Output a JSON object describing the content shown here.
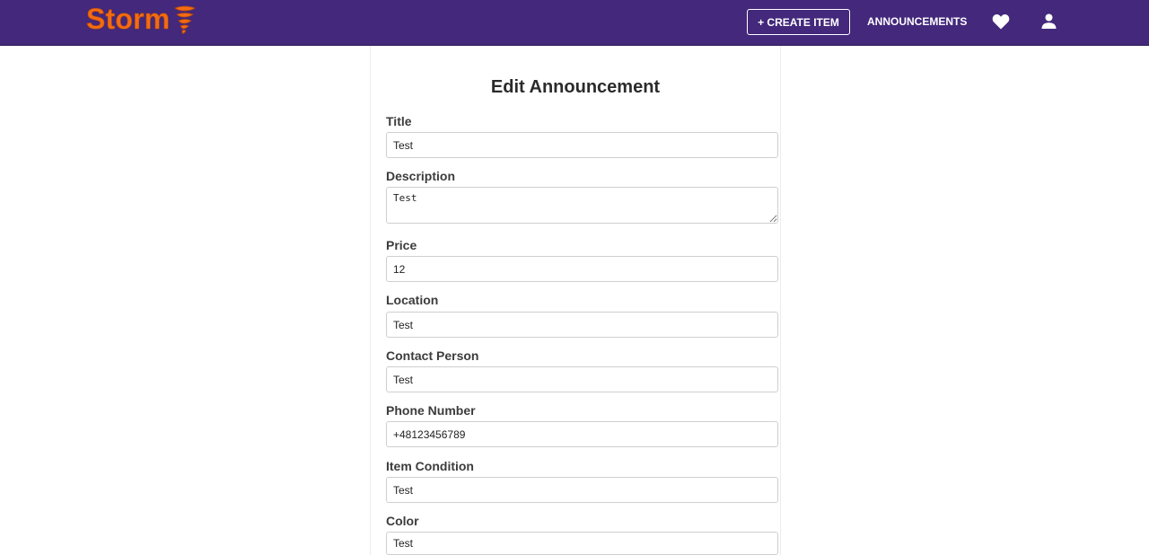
{
  "navbar": {
    "brand": "Storm",
    "create_item_label": "+ CREATE ITEM",
    "announcements_label": "ANNOUNCEMENTS",
    "icons": {
      "logo": "tornado-icon",
      "favorites": "heart-icon",
      "account": "user-icon"
    },
    "colors": {
      "background": "#43287b",
      "brand": "#f36b12"
    }
  },
  "form": {
    "title": "Edit Announcement",
    "fields": {
      "title": {
        "label": "Title",
        "value": "Test"
      },
      "description": {
        "label": "Description",
        "value": "Test"
      },
      "price": {
        "label": "Price",
        "value": "12"
      },
      "location": {
        "label": "Location",
        "value": "Test"
      },
      "contact_person": {
        "label": "Contact Person",
        "value": "Test"
      },
      "phone_number": {
        "label": "Phone Number",
        "value": "+48123456789"
      },
      "item_condition": {
        "label": "Item Condition",
        "value": "Test"
      },
      "color": {
        "label": "Color",
        "value": "Test"
      }
    }
  }
}
